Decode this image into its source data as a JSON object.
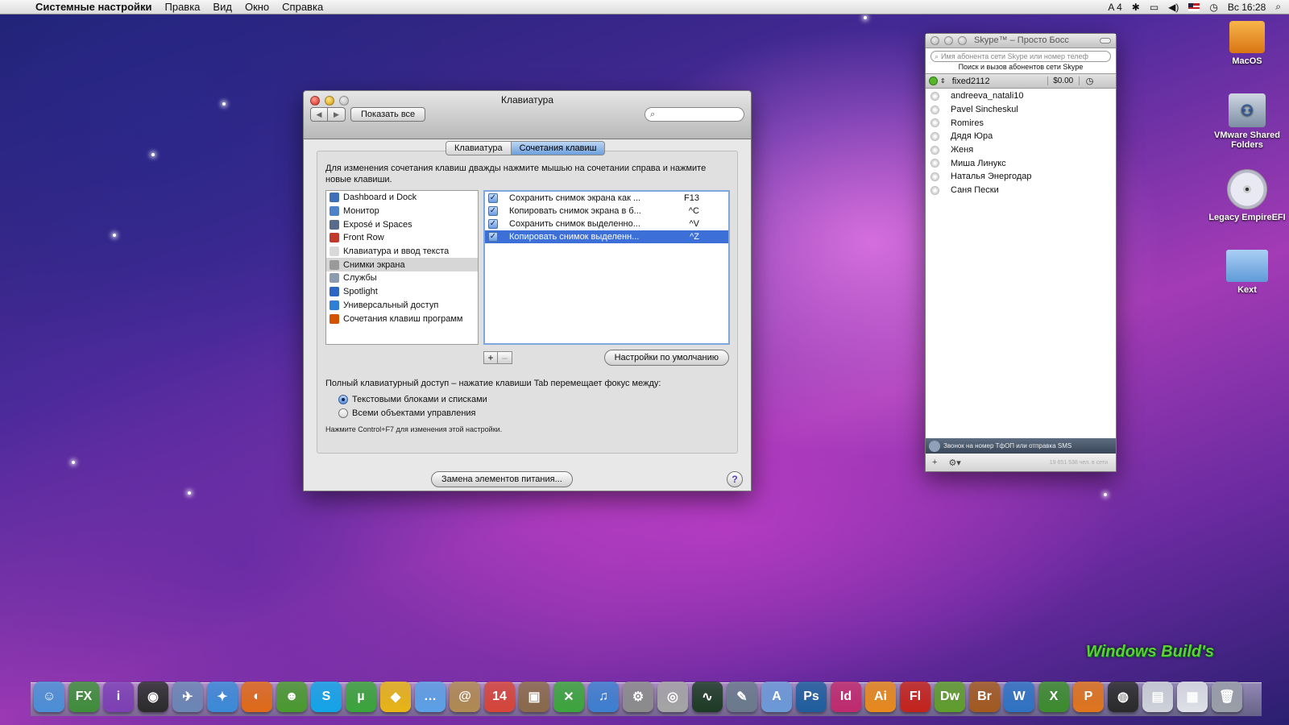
{
  "menubar": {
    "app_name": "Системные настройки",
    "menus": [
      "Правка",
      "Вид",
      "Окно",
      "Справка"
    ],
    "input_indicator": "A 4",
    "clock": "Вс 16:28"
  },
  "keyboard_window": {
    "title": "Клавиатура",
    "show_all": "Показать все",
    "search_placeholder": "",
    "tabs": [
      "Клавиатура",
      "Сочетания клавиш"
    ],
    "active_tab": "Сочетания клавиш",
    "description": "Для изменения сочетания клавиш дважды нажмите мышью на сочетании справа и нажмите новые клавиши.",
    "categories": [
      {
        "label": "Dashboard и Dock",
        "icon": "dock-icon",
        "color": "#3e6fb8"
      },
      {
        "label": "Монитор",
        "icon": "monitor-icon",
        "color": "#4f83c9"
      },
      {
        "label": "Exposé и Spaces",
        "icon": "expose-icon",
        "color": "#5a6a8a"
      },
      {
        "label": "Front Row",
        "icon": "front-row-icon",
        "color": "#c0392b"
      },
      {
        "label": "Клавиатура и ввод текста",
        "icon": "keyboard-icon",
        "color": "#d9d9d9"
      },
      {
        "label": "Снимки экрана",
        "icon": "screenshot-icon",
        "color": "#9a9a9a"
      },
      {
        "label": "Службы",
        "icon": "services-gear-icon",
        "color": "#8c9bb0"
      },
      {
        "label": "Spotlight",
        "icon": "spotlight-icon",
        "color": "#2f66c4"
      },
      {
        "label": "Универсальный доступ",
        "icon": "accessibility-icon",
        "color": "#2f7fd4"
      },
      {
        "label": "Сочетания клавиш программ",
        "icon": "app-shortcuts-icon",
        "color": "#d35400"
      }
    ],
    "selected_category": "Снимки экрана",
    "shortcuts": [
      {
        "name": "Сохранить снимок экрана как ...",
        "key": "F13",
        "checked": true
      },
      {
        "name": "Копировать снимок экрана в б...",
        "key": "^C",
        "checked": true
      },
      {
        "name": "Сохранить снимок выделенно...",
        "key": "^V",
        "checked": true
      },
      {
        "name": "Копировать снимок выделенн...",
        "key": "^Z",
        "checked": true
      }
    ],
    "plus": "+",
    "minus": "–",
    "defaults_button": "Настройки по умолчанию",
    "full_access_label": "Полный клавиатурный доступ – нажатие клавиши Tab перемещает фокус между:",
    "radio_options": [
      "Текстовыми блоками и списками",
      "Всеми объектами управления"
    ],
    "radio_selected": 0,
    "hint": "Нажмите Control+F7 для изменения этой настройки.",
    "power_button": "Замена элементов питания...",
    "help": "?"
  },
  "skype": {
    "title": "Skype™ – Просто Босс",
    "search_placeholder": "Имя абонента сети Skype или номер телеф",
    "search_caption": "Поиск и вызов абонентов сети Skype",
    "user": "fixed2112",
    "balance": "$0.00",
    "contacts": [
      "andreeva_natali10",
      "Pavel Sincheskul",
      "Romires",
      "Дядя Юра",
      "Женя",
      "Миша Линукс",
      "Наталья Энергодар",
      "Саня Пески"
    ],
    "bottom_bar": "Звонок на номер ТфОП или отправка SMS",
    "footer_add": "+",
    "footer_gear": "⚙▾",
    "online_count": "19 651 538 чел. в сети"
  },
  "desktop_icons": [
    {
      "label": "MacOS",
      "icon": "hard-drive-icon"
    },
    {
      "label": "VMware Shared Folders",
      "icon": "network-drive-icon"
    },
    {
      "label": "Legacy EmpireEFI",
      "icon": "cd-disk-icon"
    },
    {
      "label": "Kext",
      "icon": "folder-icon"
    }
  ],
  "watermark": "Windows Build's",
  "dock": [
    {
      "icon": "finder-icon",
      "glyph": "☺",
      "color": "#4b8fd6"
    },
    {
      "icon": "fx-app-icon",
      "glyph": "FX",
      "color": "#3f8e3a"
    },
    {
      "icon": "itext-icon",
      "glyph": "i",
      "color": "#7d3fb5"
    },
    {
      "icon": "dashboard-icon",
      "glyph": "◉",
      "color": "#2b2b2b"
    },
    {
      "icon": "preview-icon",
      "glyph": "✈",
      "color": "#6b86b5"
    },
    {
      "icon": "safari-icon",
      "glyph": "✦",
      "color": "#3b8ad8"
    },
    {
      "icon": "firefox-icon",
      "glyph": "◐",
      "color": "#e06a18"
    },
    {
      "icon": "adium-icon",
      "glyph": "☻",
      "color": "#4a9a2e"
    },
    {
      "icon": "skype-icon",
      "glyph": "S",
      "color": "#12a5e8"
    },
    {
      "icon": "utorrent-icon",
      "glyph": "µ",
      "color": "#3aa53a"
    },
    {
      "icon": "cyberduck-icon",
      "glyph": "◆",
      "color": "#e9b515"
    },
    {
      "icon": "ichat-icon",
      "glyph": "…",
      "color": "#5ba0e6"
    },
    {
      "icon": "address-book-icon",
      "glyph": "@",
      "color": "#b08a52"
    },
    {
      "icon": "ical-icon",
      "glyph": "14",
      "color": "#d6453a"
    },
    {
      "icon": "iphoto-icon",
      "glyph": "▣",
      "color": "#8a6a4a"
    },
    {
      "icon": "xbmc-icon",
      "glyph": "✕",
      "color": "#3ca63c"
    },
    {
      "icon": "itunes-icon",
      "glyph": "♫",
      "color": "#3d7fd0"
    },
    {
      "icon": "system-preferences-icon",
      "glyph": "⚙",
      "color": "#8b8b8b"
    },
    {
      "icon": "disk-utility-icon",
      "glyph": "◎",
      "color": "#a5a5a5"
    },
    {
      "icon": "activity-monitor-icon",
      "glyph": "∿",
      "color": "#1d3b24"
    },
    {
      "icon": "script-editor-icon",
      "glyph": "✎",
      "color": "#6a7a8c"
    },
    {
      "icon": "app-store-icon",
      "glyph": "A",
      "color": "#6b9ad8"
    },
    {
      "icon": "photoshop-icon",
      "glyph": "Ps",
      "color": "#1f5e9e"
    },
    {
      "icon": "indesign-icon",
      "glyph": "Id",
      "color": "#c02a6e"
    },
    {
      "icon": "illustrator-icon",
      "glyph": "Ai",
      "color": "#e8891c"
    },
    {
      "icon": "flash-icon",
      "glyph": "Fl",
      "color": "#c4231c"
    },
    {
      "icon": "dreamweaver-icon",
      "glyph": "Dw",
      "color": "#5f9e2c"
    },
    {
      "icon": "bridge-icon",
      "glyph": "Br",
      "color": "#a35a20"
    },
    {
      "icon": "word-icon",
      "glyph": "W",
      "color": "#2f73c4"
    },
    {
      "icon": "excel-icon",
      "glyph": "X",
      "color": "#3c8c2e"
    },
    {
      "icon": "powerpoint-icon",
      "glyph": "P",
      "color": "#e0741c"
    },
    {
      "icon": "dvd-player-icon",
      "glyph": "◍",
      "color": "#2a2a2a"
    },
    {
      "icon": "downloads-stack-icon",
      "glyph": "▤",
      "color": "#cfd3da"
    },
    {
      "icon": "documents-stack-icon",
      "glyph": "▦",
      "color": "#dfe2e8"
    },
    {
      "icon": "trash-icon",
      "glyph": "🗑",
      "color": "#9aa0a8"
    }
  ]
}
